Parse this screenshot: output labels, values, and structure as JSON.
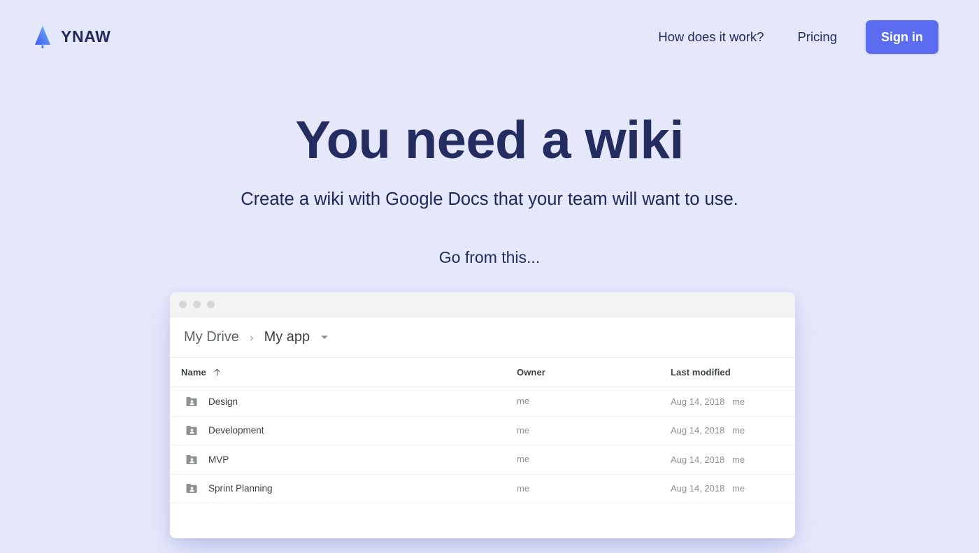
{
  "header": {
    "brand": {
      "name": "YNAW",
      "logo_icon": "pine-tree-logo-icon"
    },
    "nav": [
      {
        "id": "how-it-works",
        "label": "How does it work?"
      },
      {
        "id": "pricing",
        "label": "Pricing"
      }
    ],
    "signin_label": "Sign in"
  },
  "hero": {
    "title": "You need a wiki",
    "subtitle": "Create a wiki with Google Docs that your team will want to use.",
    "kicker": "Go from this..."
  },
  "mock": {
    "window_dots": [
      "dot-1",
      "dot-2",
      "dot-3"
    ],
    "breadcrumb": {
      "root": "My Drive",
      "separator": "›",
      "current": "My app",
      "caret_icon": "chevron-down-icon"
    },
    "table": {
      "columns": [
        {
          "id": "name",
          "label": "Name",
          "sort_icon": "sort-arrow-up-icon"
        },
        {
          "id": "owner",
          "label": "Owner"
        },
        {
          "id": "modified",
          "label": "Last modified"
        }
      ],
      "rows": [
        {
          "icon": "shared-folder-icon",
          "name": "Design",
          "owner": "me",
          "modified": "Aug 14, 2018",
          "modified_by": "me"
        },
        {
          "icon": "shared-folder-icon",
          "name": "Development",
          "owner": "me",
          "modified": "Aug 14, 2018",
          "modified_by": "me"
        },
        {
          "icon": "shared-folder-icon",
          "name": "MVP",
          "owner": "me",
          "modified": "Aug 14, 2018",
          "modified_by": "me"
        },
        {
          "icon": "shared-folder-icon",
          "name": "Sprint Planning",
          "owner": "me",
          "modified": "Aug 14, 2018",
          "modified_by": "me"
        }
      ]
    }
  },
  "colors": {
    "page_background": "#e5e7fb",
    "brand_navy": "#252c5f",
    "accent_blue": "#5c6cf0",
    "logo_gradient_start": "#4f6ef2",
    "logo_gradient_end": "#67d9f5",
    "folder_gray": "#8e9194"
  }
}
